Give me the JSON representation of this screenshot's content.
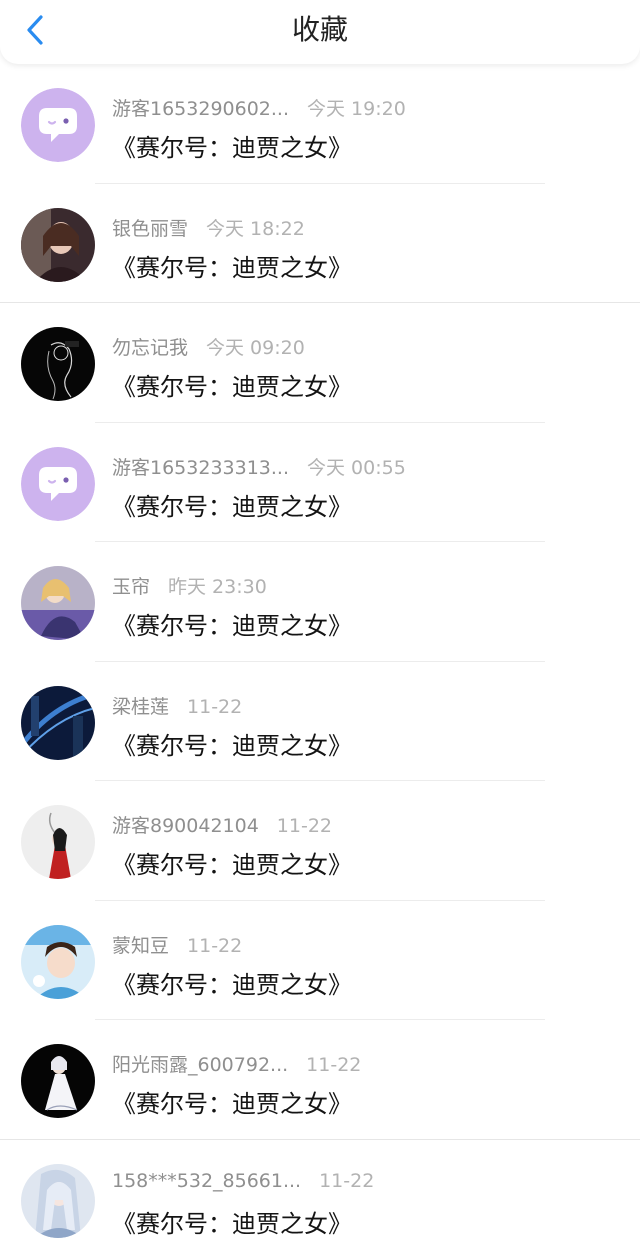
{
  "header": {
    "title": "收藏",
    "back_icon": "chevron-left-icon",
    "accent": "#2a8cf0"
  },
  "items": [
    {
      "user": "游客1653290602...",
      "time": "今天 19:20",
      "title": "《赛尔号：迪贾之女》",
      "avatar": "chat-bubble-icon"
    },
    {
      "user": "银色丽雪",
      "time": "今天 18:22",
      "title": "《赛尔号：迪贾之女》",
      "avatar": "user-photo"
    },
    {
      "user": "勿忘记我",
      "time": "今天 09:20",
      "title": "《赛尔号：迪贾之女》",
      "avatar": "user-photo"
    },
    {
      "user": "游客1653233313...",
      "time": "今天 00:55",
      "title": "《赛尔号：迪贾之女》",
      "avatar": "chat-bubble-icon"
    },
    {
      "user": "玉帘",
      "time": "昨天 23:30",
      "title": "《赛尔号：迪贾之女》",
      "avatar": "user-photo"
    },
    {
      "user": "梁桂莲",
      "time": "11-22",
      "title": "《赛尔号：迪贾之女》",
      "avatar": "user-photo"
    },
    {
      "user": "游客890042104",
      "time": "11-22",
      "title": "《赛尔号：迪贾之女》",
      "avatar": "user-photo"
    },
    {
      "user": "蒙知豆",
      "time": "11-22",
      "title": "《赛尔号：迪贾之女》",
      "avatar": "user-photo"
    },
    {
      "user": "阳光雨露_600792...",
      "time": "11-22",
      "title": "《赛尔号：迪贾之女》",
      "avatar": "user-photo"
    },
    {
      "user": "158***532_85661...",
      "time": "11-22",
      "title": "《赛尔号：迪贾之女》",
      "avatar": "user-photo"
    }
  ]
}
